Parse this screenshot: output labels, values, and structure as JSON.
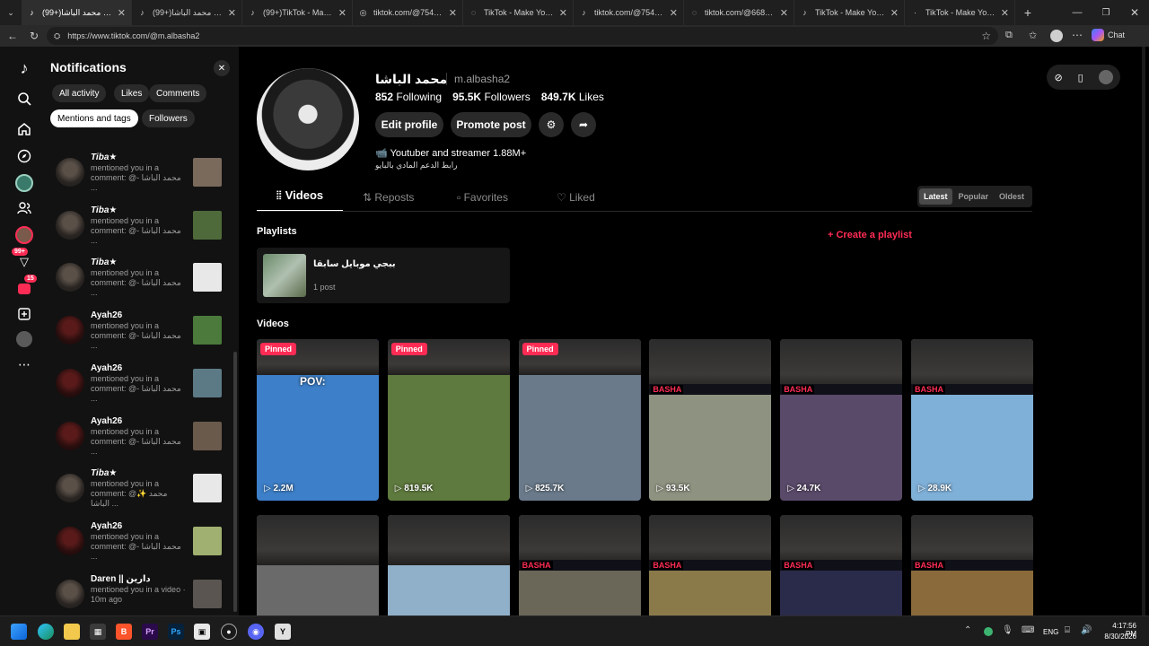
{
  "browser": {
    "tabs": [
      {
        "title": "(99+)محمد الباشا (@m.albasha2)",
        "fav": "♪"
      },
      {
        "title": "(99+)محمد الباشا (@m.albas",
        "fav": "♪"
      },
      {
        "title": "(99+)TikTok - Make Your",
        "fav": "♪"
      },
      {
        "title": "tiktok.com/@75470165",
        "fav": "◎"
      },
      {
        "title": "TikTok - Make Your Day",
        "fav": "◌"
      },
      {
        "title": "tiktok.com/@75470165",
        "fav": "♪"
      },
      {
        "title": "tiktok.com/@66822210",
        "fav": "◌"
      },
      {
        "title": "TikTok - Make Your Day",
        "fav": "♪"
      },
      {
        "title": "TikTok - Make Your Day",
        "fav": "·"
      }
    ],
    "url": "https://www.tiktok.com/@m.albasha2",
    "copilot_label": "Chat"
  },
  "leftnav": {
    "badges": {
      "inbox": "99+",
      "messages": "15"
    }
  },
  "notifications": {
    "title": "Notifications",
    "filters": [
      "All activity",
      "Likes",
      "Comments",
      "Mentions and tags",
      "Followers"
    ],
    "items": [
      {
        "name": "Tiba★",
        "text": "mentioned you in a comment: @- محمد الباشا ...",
        "italic": true,
        "thumb": "#7a6a5c"
      },
      {
        "name": "Tiba★",
        "text": "mentioned you in a comment: @- محمد الباشا ...",
        "italic": true,
        "thumb": "#4e6a3a"
      },
      {
        "name": "Tiba★",
        "text": "mentioned you in a comment: @- محمد الباشا ...",
        "italic": true,
        "thumb": "#e8e8e8"
      },
      {
        "name": "Ayah26",
        "text": "mentioned you in a comment: @- محمد الباشا ...",
        "italic": false,
        "thumb": "#4b7a3c"
      },
      {
        "name": "Ayah26",
        "text": "mentioned you in a comment: @- محمد الباشا ...",
        "italic": false,
        "thumb": "#5c7a86"
      },
      {
        "name": "Ayah26",
        "text": "mentioned you in a comment: @- محمد الباشا ...",
        "italic": false,
        "thumb": "#6a5a4c"
      },
      {
        "name": "Tiba★",
        "text": "mentioned you in a comment: @✨ محمد الباشا ...",
        "italic": true,
        "thumb": "#e8e8e8"
      },
      {
        "name": "Ayah26",
        "text": "mentioned you in a comment: @- محمد الباشا ...",
        "italic": false,
        "thumb": "#a0b070"
      },
      {
        "name": "Daren || دارين",
        "text": "mentioned you in a video · 10m ago",
        "italic": false,
        "thumb": "#5a5550"
      }
    ]
  },
  "profile": {
    "display_name": "محمد الباشا",
    "username": "m.albasha2",
    "following_count": "852",
    "following_label": "Following",
    "followers_count": "95.5K",
    "followers_label": "Followers",
    "likes_count": "849.7K",
    "likes_label": "Likes",
    "edit_profile": "Edit profile",
    "promote_post": "Promote post",
    "bio_line1": "Youtuber and streamer 1.88M+",
    "bio_line2": "رابط الدعم المادي بالبايو",
    "tabs": [
      "Videos",
      "Reposts",
      "Favorites",
      "Liked"
    ],
    "sort": [
      "Latest",
      "Popular",
      "Oldest"
    ],
    "playlists_label": "Playlists",
    "create_playlist": "+ Create a playlist",
    "playlist": {
      "title": "ببجي موبايل سابقا",
      "count": "1 post"
    },
    "videos_label": "Videos",
    "videos_row1": [
      {
        "views": "2.2M",
        "pinned": true,
        "bg": "#3d7fc8",
        "overlay": "POV:"
      },
      {
        "views": "819.5K",
        "pinned": true,
        "bg": "#5f7a3e",
        "overlay": ""
      },
      {
        "views": "825.7K",
        "pinned": true,
        "bg": "#6a7a8a",
        "overlay": ""
      },
      {
        "views": "93.5K",
        "pinned": false,
        "bg": "#8e9280",
        "overlay": ""
      },
      {
        "views": "24.7K",
        "pinned": false,
        "bg": "#5a4a6a",
        "overlay": ""
      },
      {
        "views": "28.9K",
        "pinned": false,
        "bg": "#7fb0d8",
        "overlay": ""
      }
    ],
    "videos_row2": [
      {
        "bg": "#6a6a6a"
      },
      {
        "bg": "#8fb0c8"
      },
      {
        "bg": "#6a6658"
      },
      {
        "bg": "#8a7a4a"
      },
      {
        "bg": "#2a2a4a"
      },
      {
        "bg": "#8a6a3a"
      }
    ],
    "pinned_label": "Pinned",
    "brand_tag": "BASHA"
  },
  "taskbar": {
    "lang": "ENG",
    "time": "4:17:56 PM",
    "date": "8/30/2026"
  }
}
